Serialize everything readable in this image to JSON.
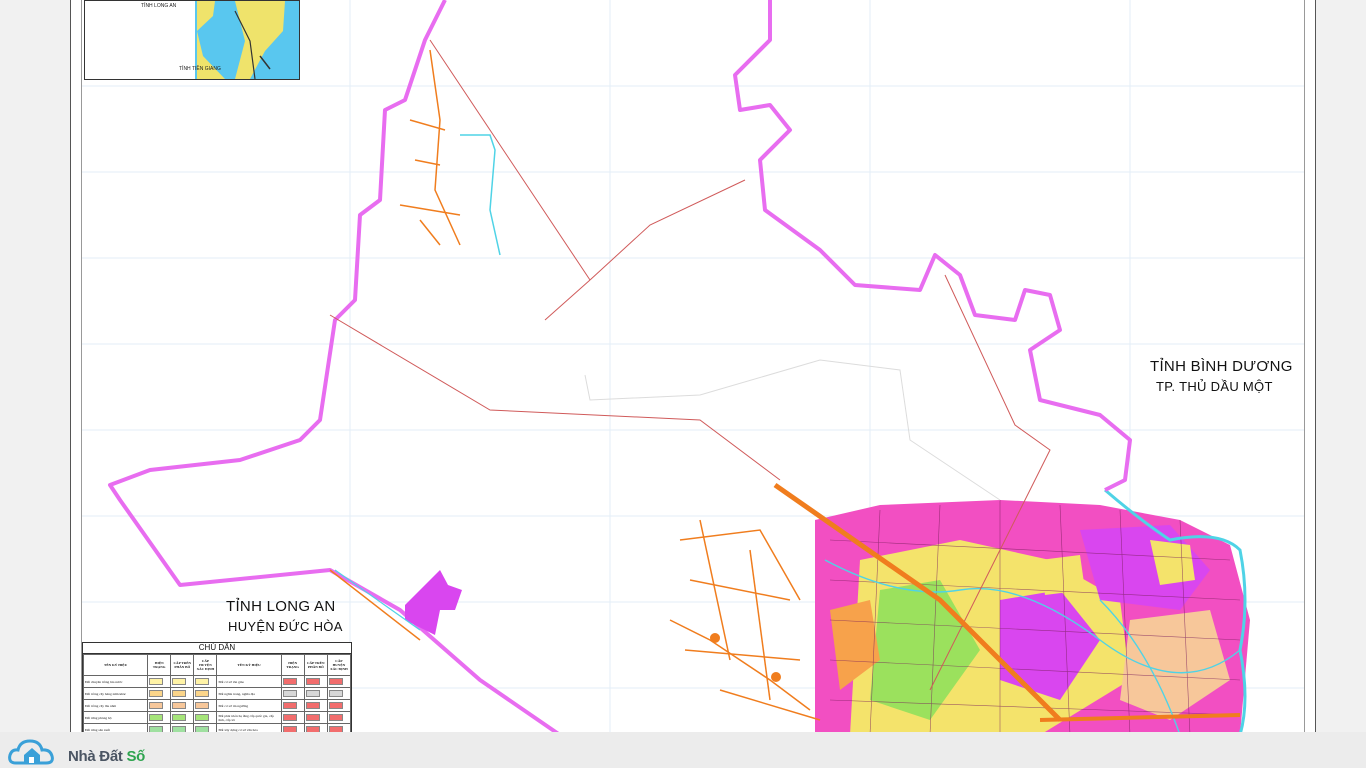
{
  "map": {
    "labels": {
      "binh_duong_province": "TỈNH BÌNH DƯƠNG",
      "thu_dau_mot": "TP. THỦ DẦU MỘT",
      "long_an_province": "TỈNH LONG AN",
      "duc_hoa": "HUYỆN ĐỨC HÒA"
    },
    "inset": {
      "long_an_label": "TỈNH LONG AN",
      "tien_giang_label": "TỈNH TIỀN GIANG"
    },
    "colors": {
      "boundary": "#f07ef0",
      "river": "#4fd3e6",
      "road": "#f07d1e",
      "residential": "#f24fc2",
      "industrial": "#d946ef",
      "agriculture": "#f4e36b",
      "green": "#9be15d",
      "water_inset": "#59c7ef",
      "land_inset": "#efe36b"
    }
  },
  "legend": {
    "title": "CHÚ DẪN",
    "headers": {
      "name_col": "TÊN KÝ HIỆU",
      "symbol_group": "KÝ HIỆU",
      "current": "HIỆN TRẠNG",
      "planning": "QUY HOẠCH",
      "allocated": "CẤP TRÊN PHÂN BỔ",
      "determined": "CẤP HUYỆN XÁC ĐỊNH"
    },
    "rows": [
      {
        "left": "Đất chuyên trồng lúa nước",
        "right": "Đất cơ sở tôn giáo"
      },
      {
        "left": "Đất trồng cây hàng năm khác",
        "right": "Đất nghĩa trang, nghĩa địa"
      },
      {
        "left": "Đất trồng cây lâu năm",
        "right": "Đất cơ sở tín ngưỡng"
      },
      {
        "left": "Đất rừng phòng hộ",
        "right": "Đất phát triển hạ tầng cấp quốc gia, cấp tỉnh, cấp xã"
      },
      {
        "left": "Đất rừng sản xuất",
        "right": "Đất xây dựng cơ sở văn hóa"
      }
    ],
    "swatch_colors_left": [
      "#fff3a6",
      "#fbd58a",
      "#f7c79a",
      "#a6e57a",
      "#9fe0a0"
    ],
    "swatch_colors_right": [
      "#f26d6d",
      "#d7d7d7",
      "#f26d6d",
      "#f26d6d",
      "#f26d6d"
    ]
  },
  "brand": {
    "name_part1": "Nhà Đất ",
    "name_part2": "Số",
    "logo_icon": "cloud-house-icon"
  }
}
